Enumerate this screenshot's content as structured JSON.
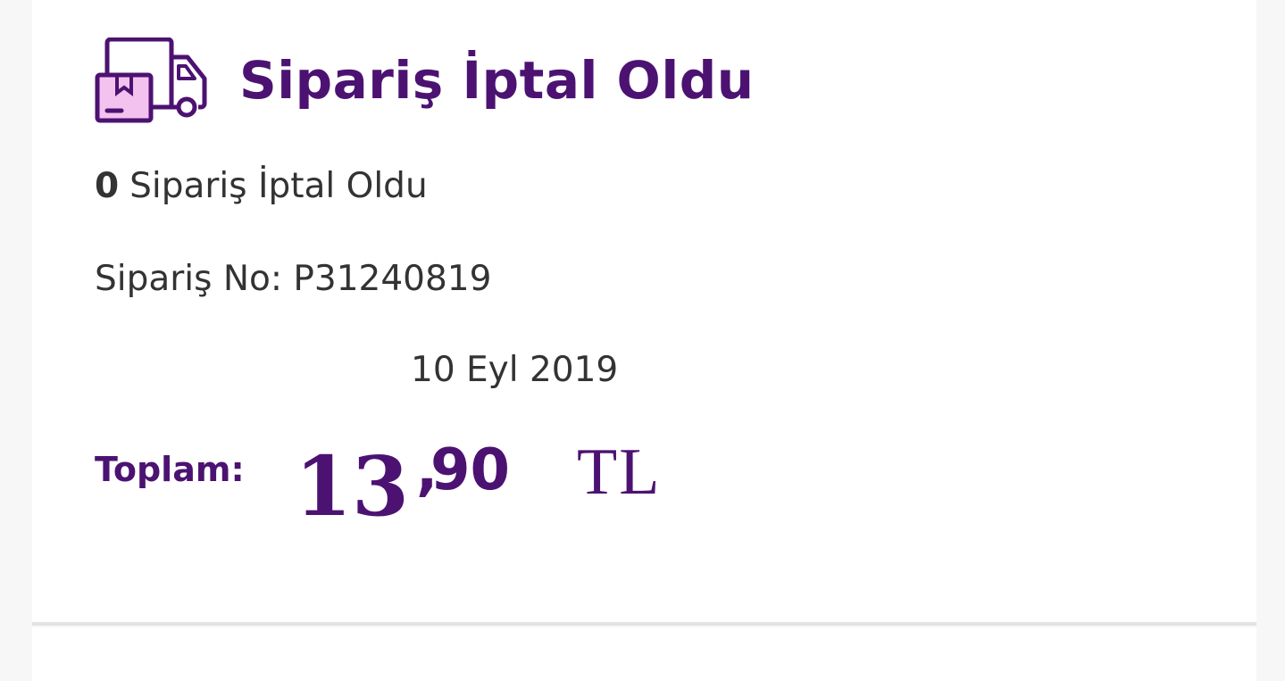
{
  "order_card": {
    "title": "Sipariş İptal Oldu",
    "icon": "delivery-truck-icon",
    "count": "0",
    "count_text": "Sipariş İptal Oldu",
    "order_no": "Sipariş No: P31240819",
    "date": "10 Eyl 2019",
    "total": {
      "label": "Toplam:",
      "integer_part": "13",
      "separator": ",",
      "decimal_part": "90",
      "currency": "TL"
    }
  },
  "colors": {
    "accent": "#4c1272",
    "icon_fill": "#f4c2ee",
    "text": "#333333",
    "background": "#f7f7f7",
    "card": "#ffffff",
    "divider": "#e3e3e3"
  }
}
